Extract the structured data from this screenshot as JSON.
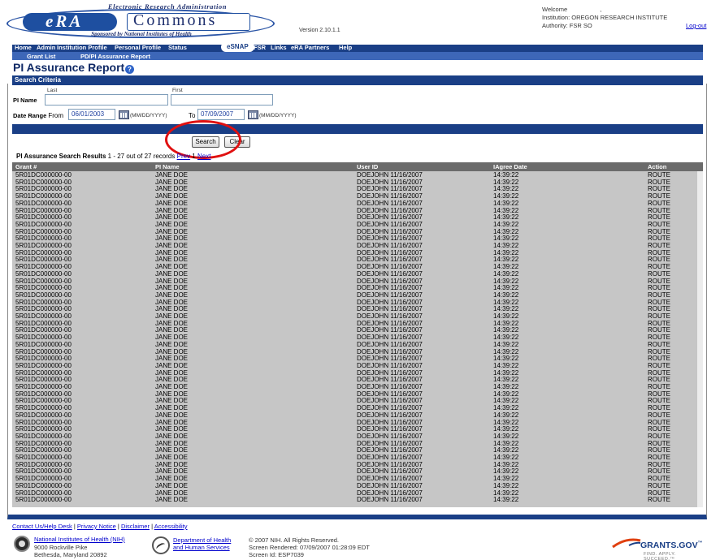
{
  "header": {
    "tagline": "Electronic Research Administration",
    "era_logo": "eRA",
    "commons_logo": "Commons",
    "sponsor": "Sponsored by National Institutes of Health",
    "version": "Version 2.10.1.1",
    "welcome": "Welcome",
    "welcome_extra": ",",
    "institution": "Institution: OREGON RESEARCH INSTITUTE",
    "authority": "Authority:  FSR SO",
    "logout": "Log-out"
  },
  "nav": {
    "items": [
      "Home",
      "Admin",
      "Institution Profile",
      "Personal Profile",
      "Status",
      "eSNAP",
      "FSR",
      "Links",
      "eRA Partners",
      "Help"
    ],
    "active": "eSNAP"
  },
  "subnav": {
    "items": [
      "Grant List",
      "PD/PI Assurance Report"
    ]
  },
  "page": {
    "title": "PI Assurance Report",
    "help_icon": "help-icon"
  },
  "criteria": {
    "section_title": "Search Criteria",
    "pi_name_label": "PI Name",
    "last_label": "Last",
    "first_label": "First",
    "last_value": "",
    "first_value": "",
    "date_range_label": "Date Range",
    "from_label": "From",
    "from_value": "06/01/2003",
    "to_label": "To",
    "to_value": "07/09/2007",
    "date_format": "(MM/DD/YYYY)",
    "search_button": "Search",
    "clear_button": "Clear"
  },
  "results": {
    "title": "PI Assurance Search Results",
    "count": "1 - 27 out of 27 records",
    "prev": "Prev",
    "page": "1",
    "next": "Next",
    "columns": [
      "Grant #",
      "PI Name",
      "User ID",
      "IAgree Date",
      "Action"
    ],
    "rows": [
      {
        "grant": "5R01DC000000-00",
        "pi": "JANE DOE",
        "user": "DOEJOHN 11/16/2007",
        "date": "14:39:22",
        "action": "ROUTE"
      },
      {
        "grant": "5R01DC000000-00",
        "pi": "JANE DOE",
        "user": "DOEJOHN 11/16/2007",
        "date": "14:39:22",
        "action": "ROUTE"
      },
      {
        "grant": "5R01DC000000-00",
        "pi": "JANE DOE",
        "user": "DOEJOHN 11/16/2007",
        "date": "14:39:22",
        "action": "ROUTE"
      },
      {
        "grant": "5R01DC000000-00",
        "pi": "JANE DOE",
        "user": "DOEJOHN 11/16/2007",
        "date": "14:39:22",
        "action": "ROUTE"
      },
      {
        "grant": "5R01DC000000-00",
        "pi": "JANE DOE",
        "user": "DOEJOHN 11/16/2007",
        "date": "14:39:22",
        "action": "ROUTE"
      },
      {
        "grant": "5R01DC000000-00",
        "pi": "JANE DOE",
        "user": "DOEJOHN 11/16/2007",
        "date": "14:39:22",
        "action": "ROUTE"
      },
      {
        "grant": "5R01DC000000-00",
        "pi": "JANE DOE",
        "user": "DOEJOHN 11/16/2007",
        "date": "14:39:22",
        "action": "ROUTE"
      },
      {
        "grant": "5R01DC000000-00",
        "pi": "JANE DOE",
        "user": "DOEJOHN 11/16/2007",
        "date": "14:39:22",
        "action": "ROUTE"
      },
      {
        "grant": "5R01DC000000-00",
        "pi": "JANE DOE",
        "user": "DOEJOHN 11/16/2007",
        "date": "14:39:22",
        "action": "ROUTE"
      },
      {
        "grant": "5R01DC000000-00",
        "pi": "JANE DOE",
        "user": "DOEJOHN 11/16/2007",
        "date": "14:39:22",
        "action": "ROUTE"
      },
      {
        "grant": "5R01DC000000-00",
        "pi": "JANE DOE",
        "user": "DOEJOHN 11/16/2007",
        "date": "14:39:22",
        "action": "ROUTE"
      },
      {
        "grant": "5R01DC000000-00",
        "pi": "JANE DOE",
        "user": "DOEJOHN 11/16/2007",
        "date": "14:39:22",
        "action": "ROUTE"
      },
      {
        "grant": "5R01DC000000-00",
        "pi": "JANE DOE",
        "user": "DOEJOHN 11/16/2007",
        "date": "14:39:22",
        "action": "ROUTE"
      },
      {
        "grant": "5R01DC000000-00",
        "pi": "JANE DOE",
        "user": "DOEJOHN 11/16/2007",
        "date": "14:39:22",
        "action": "ROUTE"
      },
      {
        "grant": "5R01DC000000-00",
        "pi": "JANE DOE",
        "user": "DOEJOHN 11/16/2007",
        "date": "14:39:22",
        "action": "ROUTE"
      },
      {
        "grant": "5R01DC000000-00",
        "pi": "JANE DOE",
        "user": "DOEJOHN 11/16/2007",
        "date": "14:39:22",
        "action": "ROUTE"
      },
      {
        "grant": "5R01DC000000-00",
        "pi": "JANE DOE",
        "user": "DOEJOHN 11/16/2007",
        "date": "14:39:22",
        "action": "ROUTE"
      },
      {
        "grant": "5R01DC000000-00",
        "pi": "JANE DOE",
        "user": "DOEJOHN 11/16/2007",
        "date": "14:39:22",
        "action": "ROUTE"
      },
      {
        "grant": "5R01DC000000-00",
        "pi": "JANE DOE",
        "user": "DOEJOHN 11/16/2007",
        "date": "14:39:22",
        "action": "ROUTE"
      },
      {
        "grant": "5R01DC000000-00",
        "pi": "JANE DOE",
        "user": "DOEJOHN 11/16/2007",
        "date": "14:39:22",
        "action": "ROUTE"
      },
      {
        "grant": "5R01DC000000-00",
        "pi": "JANE DOE",
        "user": "DOEJOHN 11/16/2007",
        "date": "14:39:22",
        "action": "ROUTE"
      },
      {
        "grant": "5R01DC000000-00",
        "pi": "JANE DOE",
        "user": "DOEJOHN 11/16/2007",
        "date": "14:39:22",
        "action": "ROUTE"
      },
      {
        "grant": "5R01DC000000-00",
        "pi": "JANE DOE",
        "user": "DOEJOHN 11/16/2007",
        "date": "14:39:22",
        "action": "ROUTE"
      },
      {
        "grant": "5R01DC000000-00",
        "pi": "JANE DOE",
        "user": "DOEJOHN 11/16/2007",
        "date": "14:39:22",
        "action": "ROUTE"
      },
      {
        "grant": "5R01DC000000-00",
        "pi": "JANE DOE",
        "user": "DOEJOHN 11/16/2007",
        "date": "14:39:22",
        "action": "ROUTE"
      },
      {
        "grant": "5R01DC000000-00",
        "pi": "JANE DOE",
        "user": "DOEJOHN 11/16/2007",
        "date": "14:39:22",
        "action": "ROUTE"
      },
      {
        "grant": "5R01DC000000-00",
        "pi": "JANE DOE",
        "user": "DOEJOHN 11/16/2007",
        "date": "14:39:22",
        "action": "ROUTE"
      },
      {
        "grant": "5R01DC000000-00",
        "pi": "JANE DOE",
        "user": "DOEJOHN 11/16/2007",
        "date": "14:39:22",
        "action": "ROUTE"
      },
      {
        "grant": "5R01DC000000-00",
        "pi": "JANE DOE",
        "user": "DOEJOHN 11/16/2007",
        "date": "14:39:22",
        "action": "ROUTE"
      },
      {
        "grant": "5R01DC000000-00",
        "pi": "JANE DOE",
        "user": "DOEJOHN 11/16/2007",
        "date": "14:39:22",
        "action": "ROUTE"
      },
      {
        "grant": "5R01DC000000-00",
        "pi": "JANE DOE",
        "user": "DOEJOHN 11/16/2007",
        "date": "14:39:22",
        "action": "ROUTE"
      },
      {
        "grant": "5R01DC000000-00",
        "pi": "JANE DOE",
        "user": "DOEJOHN 11/16/2007",
        "date": "14:39:22",
        "action": "ROUTE"
      },
      {
        "grant": "5R01DC000000-00",
        "pi": "JANE DOE",
        "user": "DOEJOHN 11/16/2007",
        "date": "14:39:22",
        "action": "ROUTE"
      },
      {
        "grant": "5R01DC000000-00",
        "pi": "JANE DOE",
        "user": "DOEJOHN 11/16/2007",
        "date": "14:39:22",
        "action": "ROUTE"
      },
      {
        "grant": "5R01DC000000-00",
        "pi": "JANE DOE",
        "user": "DOEJOHN 11/16/2007",
        "date": "14:39:22",
        "action": "ROUTE"
      },
      {
        "grant": "5R01DC000000-00",
        "pi": "JANE DOE",
        "user": "DOEJOHN 11/16/2007",
        "date": "14:39:22",
        "action": "ROUTE"
      },
      {
        "grant": "5R01DC000000-00",
        "pi": "JANE DOE",
        "user": "DOEJOHN 11/16/2007",
        "date": "14:39:22",
        "action": "ROUTE"
      },
      {
        "grant": "5R01DC000000-00",
        "pi": "JANE DOE",
        "user": "DOEJOHN 11/16/2007",
        "date": "14:39:22",
        "action": "ROUTE"
      },
      {
        "grant": "5R01DC000000-00",
        "pi": "JANE DOE",
        "user": "DOEJOHN 11/16/2007",
        "date": "14:39:22",
        "action": "ROUTE"
      },
      {
        "grant": "5R01DC000000-00",
        "pi": "JANE DOE",
        "user": "DOEJOHN 11/16/2007",
        "date": "14:39:22",
        "action": "ROUTE"
      },
      {
        "grant": "5R01DC000000-00",
        "pi": "JANE DOE",
        "user": "DOEJOHN 11/16/2007",
        "date": "14:39:22",
        "action": "ROUTE"
      },
      {
        "grant": "5R01DC000000-00",
        "pi": "JANE DOE",
        "user": "DOEJOHN 11/16/2007",
        "date": "14:39:22",
        "action": "ROUTE"
      },
      {
        "grant": "5R01DC000000-00",
        "pi": "JANE DOE",
        "user": "DOEJOHN 11/16/2007",
        "date": "14:39:22",
        "action": "ROUTE"
      },
      {
        "grant": "5R01DC000000-00",
        "pi": "JANE DOE",
        "user": "DOEJOHN 11/16/2007",
        "date": "14:39:22",
        "action": "ROUTE"
      },
      {
        "grant": "5R01DC000000-00",
        "pi": "JANE DOE",
        "user": "DOEJOHN 11/16/2007",
        "date": "14:39:22",
        "action": "ROUTE"
      },
      {
        "grant": "5R01DC000000-00",
        "pi": "JANE DOE",
        "user": "DOEJOHN 11/16/2007",
        "date": "14:39:22",
        "action": "ROUTE"
      },
      {
        "grant": "5R01DC000000-00",
        "pi": "JANE DOE",
        "user": "DOEJOHN 11/16/2007",
        "date": "14:39:22",
        "action": "ROUTE"
      }
    ]
  },
  "footer": {
    "links": [
      "Contact Us/Help Desk",
      "Privacy Notice",
      "Disclaimer",
      "Accessibility"
    ],
    "nih_name": "National Institutes of Health (NIH)",
    "nih_addr1": "9000 Rockville Pike",
    "nih_addr2": "Bethesda, Maryland 20892",
    "hhs_name1": "Department of Health",
    "hhs_name2": "and Human Services",
    "copyright": "© 2007 NIH. All Rights Reserved.",
    "rendered": "Screen Rendered: 07/09/2007 01:28:09 EDT",
    "screen_id": "Screen Id: ESP7039",
    "grants_logo": "GRANTS.GOV",
    "grants_mark": "™",
    "grants_tag": "FIND. APPLY. SUCCEED.",
    "grants_tag_mark": "™"
  },
  "colors": {
    "nav_blue": "#1a3f86",
    "subnav_blue": "#3d67b8",
    "table_header": "#6b6b6b",
    "table_body": "#c6c6c6",
    "highlight_circle": "#e01010"
  }
}
